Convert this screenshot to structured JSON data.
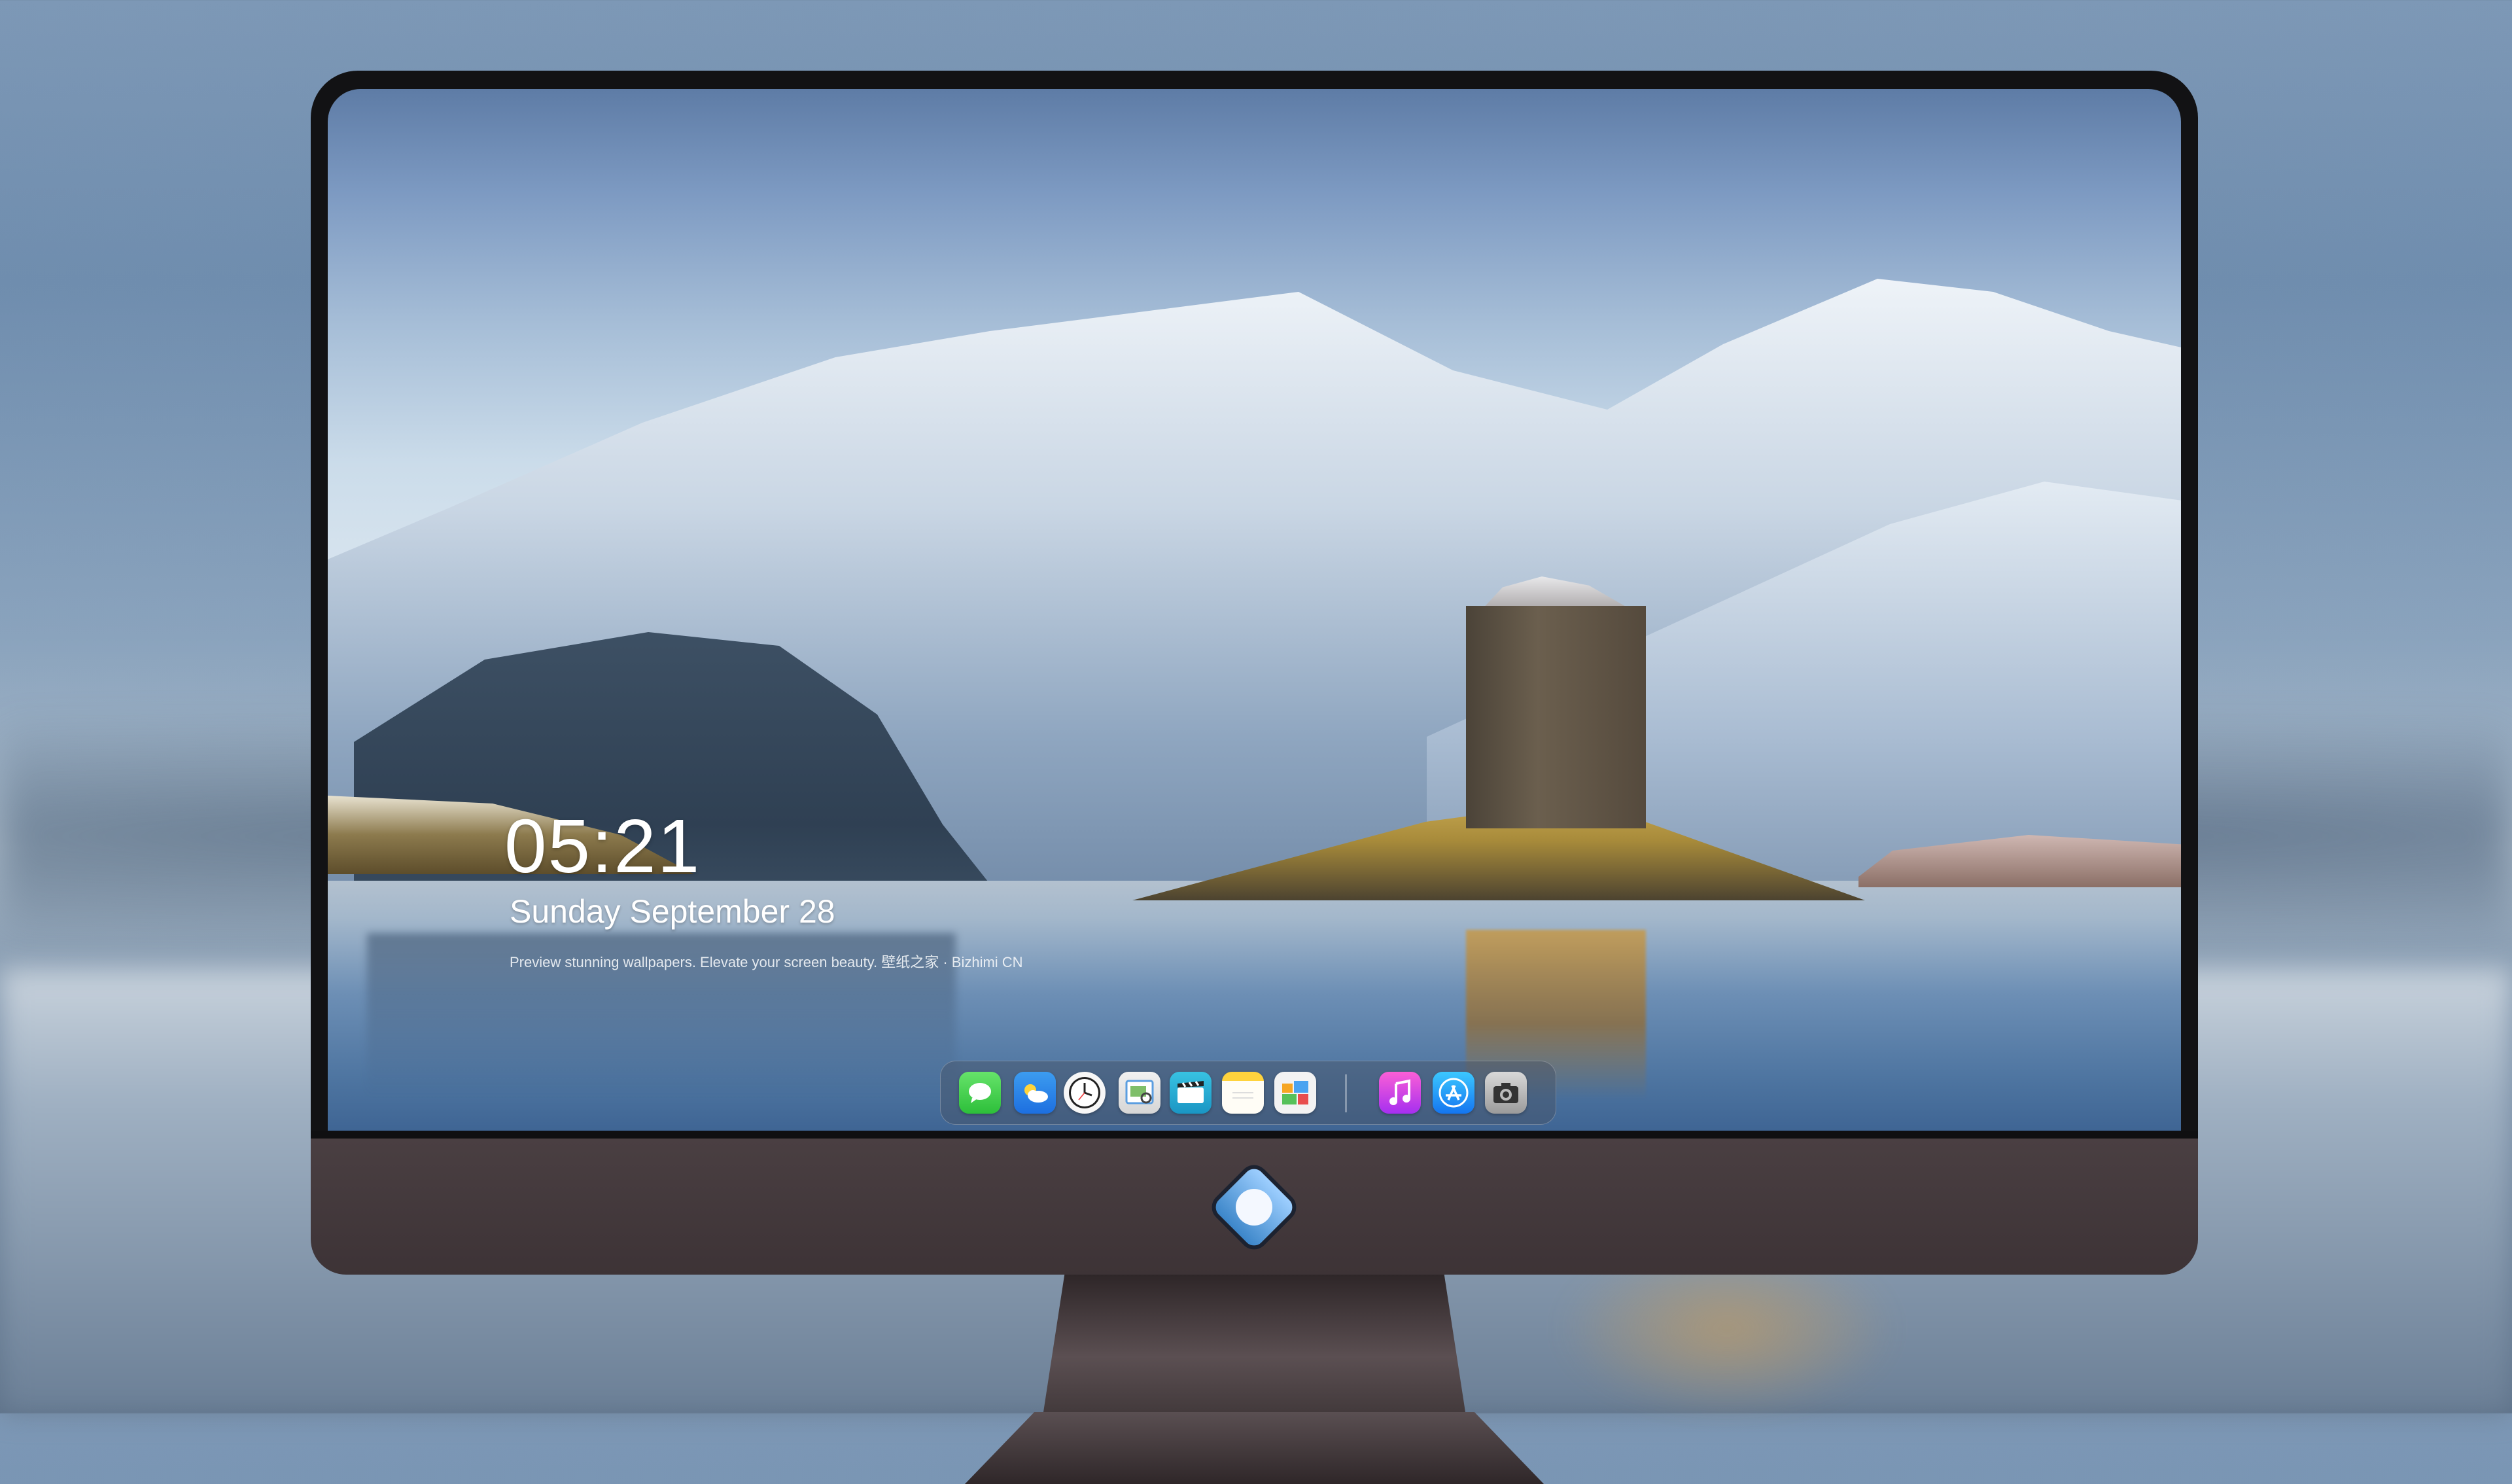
{
  "lockscreen": {
    "time": "05:21",
    "date": "Sunday September  28",
    "tagline": "Preview stunning wallpapers. Elevate your screen beauty. 壁纸之家 · Bizhimi CN"
  },
  "dock": {
    "apps": [
      {
        "name": "Messages",
        "icon": "messages-icon"
      },
      {
        "name": "Weather",
        "icon": "weather-icon"
      },
      {
        "name": "Clock",
        "icon": "clock-icon"
      },
      {
        "name": "Preview",
        "icon": "preview-icon"
      },
      {
        "name": "Clips",
        "icon": "clips-icon"
      },
      {
        "name": "Notes",
        "icon": "notes-icon"
      },
      {
        "name": "Photos",
        "icon": "photos-icon"
      },
      {
        "name": "Music",
        "icon": "music-icon"
      },
      {
        "name": "App Store",
        "icon": "app-store-icon"
      },
      {
        "name": "Camera",
        "icon": "camera-icon"
      }
    ]
  },
  "colors": {
    "bezel": "#121214",
    "chin": "#4a3f42",
    "text": "#ffffff"
  }
}
